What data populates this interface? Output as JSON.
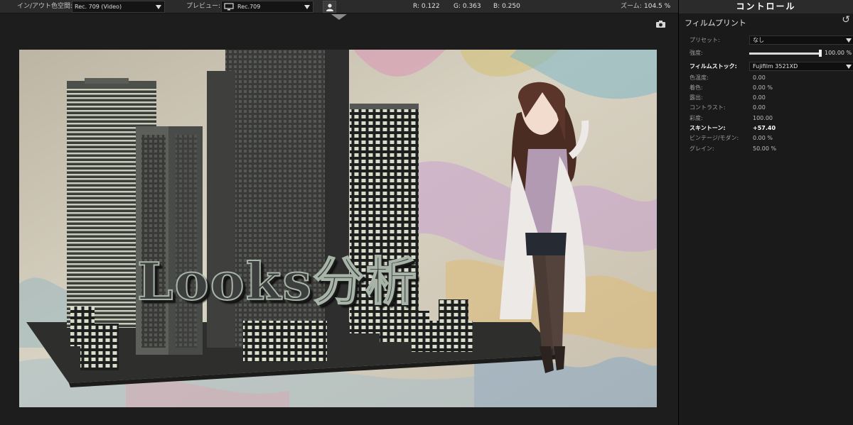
{
  "toolbar": {
    "colorspace_label": "イン/アウト色空間:",
    "colorspace_value": "Rec. 709 (Video)",
    "preview_label": "プレビュー:",
    "preview_value": "Rec.709",
    "r_readout": "R: 0.122",
    "g_readout": "G: 0.363",
    "b_readout": "B: 0.250",
    "zoom_label": "ズーム:",
    "zoom_value": "104.5 %"
  },
  "viewer": {
    "overlay_title": "Looks分析"
  },
  "panel": {
    "header": "コントロール",
    "section_title": "フィルムプリント",
    "reset_glyph": "↺",
    "preset_label": "プリセット:",
    "preset_value": "なし",
    "strength_label": "強度:",
    "strength_value": "100.00 %",
    "strength_level": 1.0,
    "filmstock_label": "フィルムストック:",
    "filmstock_value": "Fujifilm 3521XD",
    "params": [
      {
        "label": "色温度:",
        "value": "0.00"
      },
      {
        "label": "着色:",
        "value": "0.00 %"
      },
      {
        "label": "露出:",
        "value": "0.00"
      },
      {
        "label": "コントラスト:",
        "value": "0.00"
      },
      {
        "label": "彩度:",
        "value": "100.00"
      },
      {
        "label": "スキントーン:",
        "value": "+57.40"
      },
      {
        "label": "ビンテージ/モダン:",
        "value": "0.00 %"
      },
      {
        "label": "グレイン:",
        "value": "50.00 %"
      }
    ]
  },
  "icons": [
    "caret-down-icon",
    "monitor-icon",
    "person-icon",
    "camera-icon",
    "reset-icon"
  ]
}
